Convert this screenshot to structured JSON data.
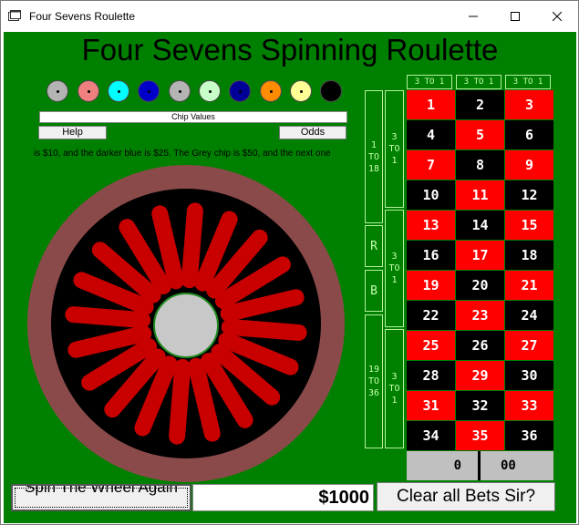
{
  "window": {
    "title": "Four Sevens Roulette",
    "icon": "app-icon"
  },
  "app": {
    "heading": "Four Sevens Spinning Roulette"
  },
  "chips": [
    {
      "color": "#b4b4b4"
    },
    {
      "color": "#f08080"
    },
    {
      "color": "#00ffff"
    },
    {
      "color": "#0000c8"
    },
    {
      "color": "#b4b4b4"
    },
    {
      "color": "#c8ffc8"
    },
    {
      "color": "#000096"
    },
    {
      "color": "#ff8c00"
    },
    {
      "color": "#ffff96"
    },
    {
      "color": "#000000"
    }
  ],
  "controls": {
    "chip_values_label": "Chip Values",
    "help_label": "Help",
    "odds_label": "Odds",
    "info_text": "is $10, and the darker blue is $25. The Grey chip is $50, and the next one"
  },
  "board": {
    "column_headers": [
      "3 TO 1",
      "3 TO 1",
      "3 TO 1"
    ],
    "rows": [
      [
        {
          "n": "1",
          "c": "red"
        },
        {
          "n": "2",
          "c": "black"
        },
        {
          "n": "3",
          "c": "red"
        }
      ],
      [
        {
          "n": "4",
          "c": "black"
        },
        {
          "n": "5",
          "c": "red"
        },
        {
          "n": "6",
          "c": "black"
        }
      ],
      [
        {
          "n": "7",
          "c": "red"
        },
        {
          "n": "8",
          "c": "black"
        },
        {
          "n": "9",
          "c": "red"
        }
      ],
      [
        {
          "n": "10",
          "c": "black"
        },
        {
          "n": "11",
          "c": "red"
        },
        {
          "n": "12",
          "c": "black"
        }
      ],
      [
        {
          "n": "13",
          "c": "red"
        },
        {
          "n": "14",
          "c": "black"
        },
        {
          "n": "15",
          "c": "red"
        }
      ],
      [
        {
          "n": "16",
          "c": "black"
        },
        {
          "n": "17",
          "c": "red"
        },
        {
          "n": "18",
          "c": "black"
        }
      ],
      [
        {
          "n": "19",
          "c": "red"
        },
        {
          "n": "20",
          "c": "black"
        },
        {
          "n": "21",
          "c": "red"
        }
      ],
      [
        {
          "n": "22",
          "c": "black"
        },
        {
          "n": "23",
          "c": "red"
        },
        {
          "n": "24",
          "c": "black"
        }
      ],
      [
        {
          "n": "25",
          "c": "red"
        },
        {
          "n": "26",
          "c": "black"
        },
        {
          "n": "27",
          "c": "red"
        }
      ],
      [
        {
          "n": "28",
          "c": "black"
        },
        {
          "n": "29",
          "c": "red"
        },
        {
          "n": "30",
          "c": "black"
        }
      ],
      [
        {
          "n": "31",
          "c": "red"
        },
        {
          "n": "32",
          "c": "black"
        },
        {
          "n": "33",
          "c": "red"
        }
      ],
      [
        {
          "n": "34",
          "c": "black"
        },
        {
          "n": "35",
          "c": "red"
        },
        {
          "n": "36",
          "c": "black"
        }
      ]
    ],
    "zero": "0",
    "double_zero": "00",
    "outside": {
      "low": [
        "1",
        "TO",
        "18"
      ],
      "red": "R",
      "black": "B",
      "high": [
        "19",
        "TO",
        "36"
      ],
      "dozen1": [
        "3",
        "TO",
        "1"
      ],
      "dozen2": [
        "3",
        "TO",
        "1"
      ],
      "dozen3": [
        "3",
        "TO",
        "1"
      ]
    }
  },
  "bottom": {
    "spin_label": "Spin The Wheel Again",
    "bank": "$1000",
    "clear_label": "Clear all Bets Sir?"
  },
  "colors": {
    "table_green": "#008000",
    "red": "#ff0000",
    "black": "#000000",
    "wheel_rim": "#8b4a4a",
    "spoke_red": "#c80000",
    "hub": "#c8c8c8"
  }
}
